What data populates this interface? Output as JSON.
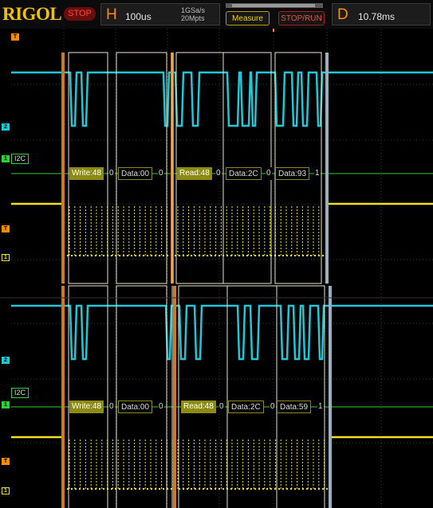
{
  "header": {
    "logo": "RIGOL",
    "status": "STOP",
    "horizontal": {
      "letter": "H",
      "timebase": "100us",
      "sample_rate": "1GSa/s",
      "memory_depth": "20Mpts"
    },
    "delay": {
      "letter": "D",
      "value": "10.78ms"
    },
    "measure_label": "Measure",
    "stop_run_label": "STOP/RUN"
  },
  "colors": {
    "ch1": "#1ec8d8",
    "ch2": "#f0e020",
    "decode": "#2fd02f",
    "packet_border": "#e8e6c8",
    "start_marker": "#d07a1a",
    "stop_marker": "#9ab0c0",
    "address_chip": "#8c8a12"
  },
  "markers": {
    "trigger": "T",
    "ch2": "2",
    "ch1": "1",
    "ch2_alt": "T",
    "ch3": "1"
  },
  "upper_view": {
    "bus_label": "I2C",
    "packets": [
      {
        "type": "address",
        "label": "Write:48",
        "ack": "0"
      },
      {
        "type": "data",
        "label": "Data:00",
        "ack": "0"
      },
      {
        "type": "address",
        "label": "Read:48",
        "ack": "0"
      },
      {
        "type": "data",
        "label": "Data:2C",
        "ack": "0"
      },
      {
        "type": "data",
        "label": "Data:93",
        "ack": "1"
      }
    ]
  },
  "lower_view": {
    "bus_label": "I2C",
    "packets": [
      {
        "type": "address",
        "label": "Write:48",
        "ack": "0"
      },
      {
        "type": "data",
        "label": "Data:00",
        "ack": "0"
      },
      {
        "type": "address",
        "label": "Read:48",
        "ack": "0"
      },
      {
        "type": "data",
        "label": "Data:2C",
        "ack": "0"
      },
      {
        "type": "data",
        "label": "Data:59",
        "ack": "1"
      }
    ]
  }
}
